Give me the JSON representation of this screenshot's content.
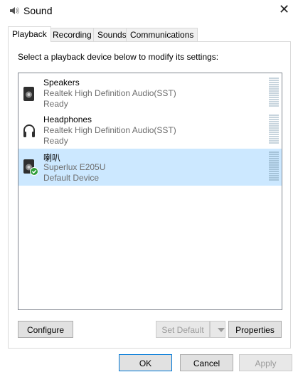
{
  "window": {
    "title": "Sound",
    "close_glyph": "✕"
  },
  "tabs": [
    {
      "label": "Playback",
      "active": true
    },
    {
      "label": "Recording",
      "active": false
    },
    {
      "label": "Sounds",
      "active": false
    },
    {
      "label": "Communications",
      "active": false
    }
  ],
  "panel": {
    "instruction": "Select a playback device below to modify its settings:"
  },
  "devices": [
    {
      "name": "Speakers",
      "description": "Realtek High Definition Audio(SST)",
      "status": "Ready",
      "icon": "speaker-icon",
      "selected": false
    },
    {
      "name": "Headphones",
      "description": "Realtek High Definition Audio(SST)",
      "status": "Ready",
      "icon": "headphones-icon",
      "selected": false
    },
    {
      "name": "喇叭",
      "description": "Superlux E205U",
      "status": "Default Device",
      "icon": "speaker-default-icon",
      "selected": true
    }
  ],
  "buttons": {
    "configure": "Configure",
    "set_default": "Set Default",
    "properties": "Properties",
    "ok": "OK",
    "cancel": "Cancel",
    "apply": "Apply"
  },
  "colors": {
    "selection": "#cce8ff",
    "default_check": "#2e9e3a",
    "primary_border": "#0078d7"
  }
}
